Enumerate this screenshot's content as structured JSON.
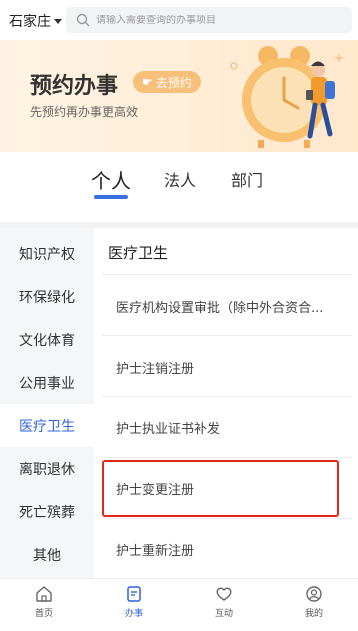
{
  "top_bar": {
    "city": "石家庄",
    "search_placeholder": "请输入需要查询的办事项目"
  },
  "banner": {
    "title": "预约办事",
    "button_label": "去预约",
    "subtitle": "先预约再办事更高效"
  },
  "tabs": [
    {
      "label": "个人",
      "active": true
    },
    {
      "label": "法人",
      "active": false
    },
    {
      "label": "部门",
      "active": false
    }
  ],
  "sidebar": {
    "items": [
      {
        "label": "知识产权"
      },
      {
        "label": "环保绿化"
      },
      {
        "label": "文化体育"
      },
      {
        "label": "公用事业"
      },
      {
        "label": "医疗卫生",
        "active": true
      },
      {
        "label": "离职退休"
      },
      {
        "label": "死亡殡葬"
      },
      {
        "label": "其他"
      }
    ]
  },
  "content": {
    "category_title": "医疗卫生",
    "services": [
      {
        "label": "医疗机构设置审批（除中外合资合..."
      },
      {
        "label": "护士注销注册"
      },
      {
        "label": "护士执业证书补发"
      },
      {
        "label": "护士变更注册",
        "highlighted": true
      },
      {
        "label": "护士重新注册"
      }
    ]
  },
  "bottom_nav": [
    {
      "label": "首页",
      "icon": "home-icon"
    },
    {
      "label": "办事",
      "icon": "document-icon",
      "active": true
    },
    {
      "label": "互动",
      "icon": "heart-icon"
    },
    {
      "label": "我的",
      "icon": "user-icon"
    }
  ],
  "colors": {
    "accent": "#2f63d8",
    "highlight_border": "#e1261c",
    "banner_bg": "#ffe8cc",
    "pill_bg": "#f6c07a"
  }
}
